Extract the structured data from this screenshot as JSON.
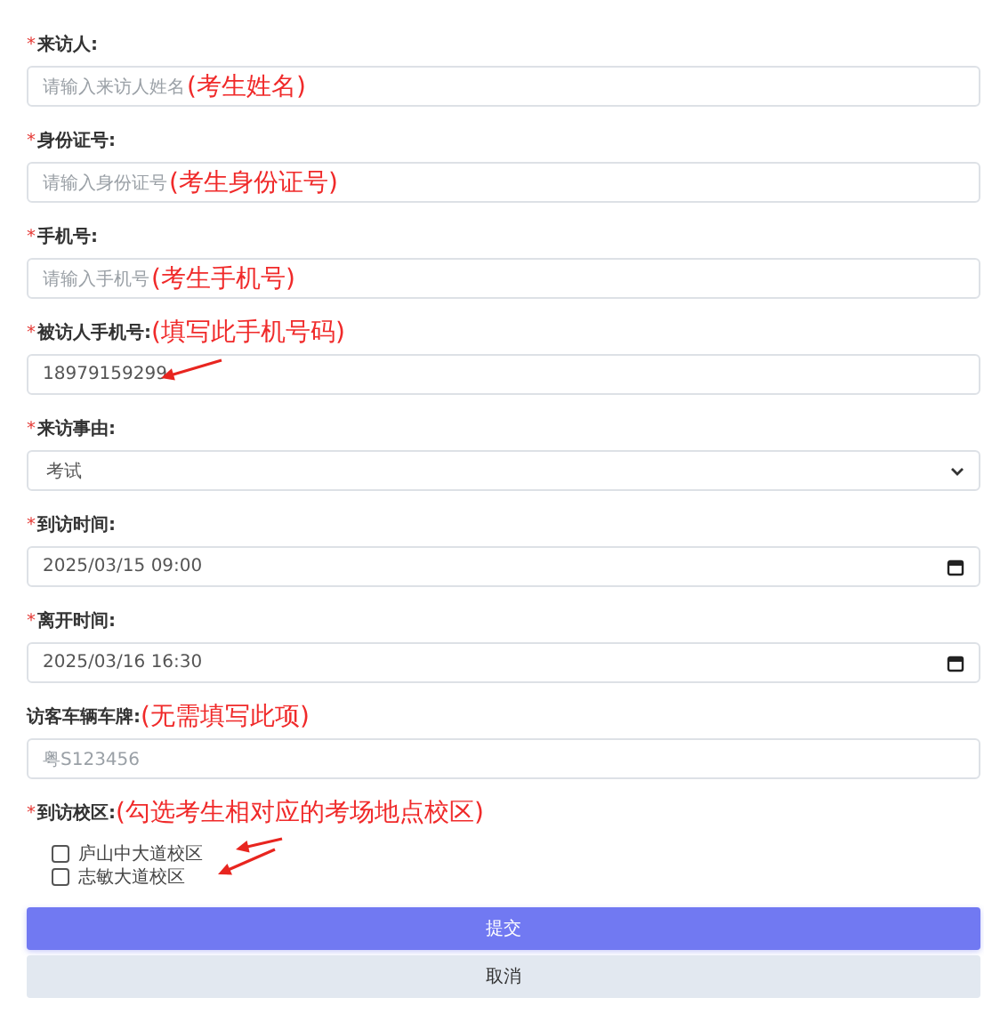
{
  "fields": [
    {
      "kind": "text",
      "marker": "*",
      "label": "来访人:",
      "placeholder": "请输入来访人姓名",
      "field_annotation": "(考生姓名)"
    },
    {
      "kind": "text",
      "marker": "*",
      "label": "身份证号:",
      "placeholder": "请输入身份证号",
      "field_annotation": "(考生身份证号)"
    },
    {
      "kind": "text",
      "marker": "*",
      "label": "手机号:",
      "placeholder": "请输入手机号",
      "field_annotation": "(考生手机号)"
    },
    {
      "kind": "text",
      "marker": "*",
      "label": "被访人手机号:",
      "value": "18979159299",
      "label_annotation": "(填写此手机号码)",
      "arrow": true
    },
    {
      "kind": "select",
      "marker": "*",
      "label": "来访事由:",
      "value": "考试"
    },
    {
      "kind": "datetime",
      "marker": "*",
      "label": "到访时间:",
      "value": "2025/03/15 09:00"
    },
    {
      "kind": "datetime",
      "marker": "*",
      "label": "离开时间:",
      "value": "2025/03/16 16:30"
    },
    {
      "kind": "text",
      "label": "访客车辆车牌:",
      "placeholder": "粤S123456",
      "label_annotation": "(无需填写此项)"
    },
    {
      "kind": "checkboxes",
      "marker": "*",
      "label": "到访校区:",
      "label_annotation": "(勾选考生相对应的考场地点校区)",
      "options": [
        {
          "label": "庐山中大道校区",
          "checked": false,
          "arrow": true
        },
        {
          "label": "志敏大道校区",
          "checked": false,
          "arrow": true
        }
      ]
    }
  ],
  "buttons": [
    {
      "kind": "primary",
      "label": "提交"
    },
    {
      "kind": "secondary",
      "label": "取消"
    }
  ]
}
